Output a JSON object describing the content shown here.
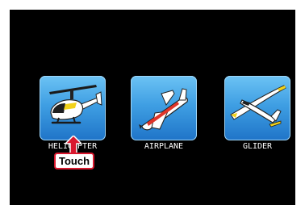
{
  "model_types": [
    {
      "label": "HELICOPTER",
      "icon": "helicopter-icon"
    },
    {
      "label": "AIRPLANE",
      "icon": "airplane-icon"
    },
    {
      "label": "GLIDER",
      "icon": "glider-icon"
    }
  ],
  "touch_hint": {
    "label": "Touch",
    "arrow_icon": "up-arrow-icon",
    "color": "#d9182e"
  },
  "colors": {
    "screen_background": "#000000",
    "tile_gradient_top": "#6cc3f4",
    "tile_gradient_bottom": "#1f74c8",
    "label_text": "#ffffff"
  }
}
